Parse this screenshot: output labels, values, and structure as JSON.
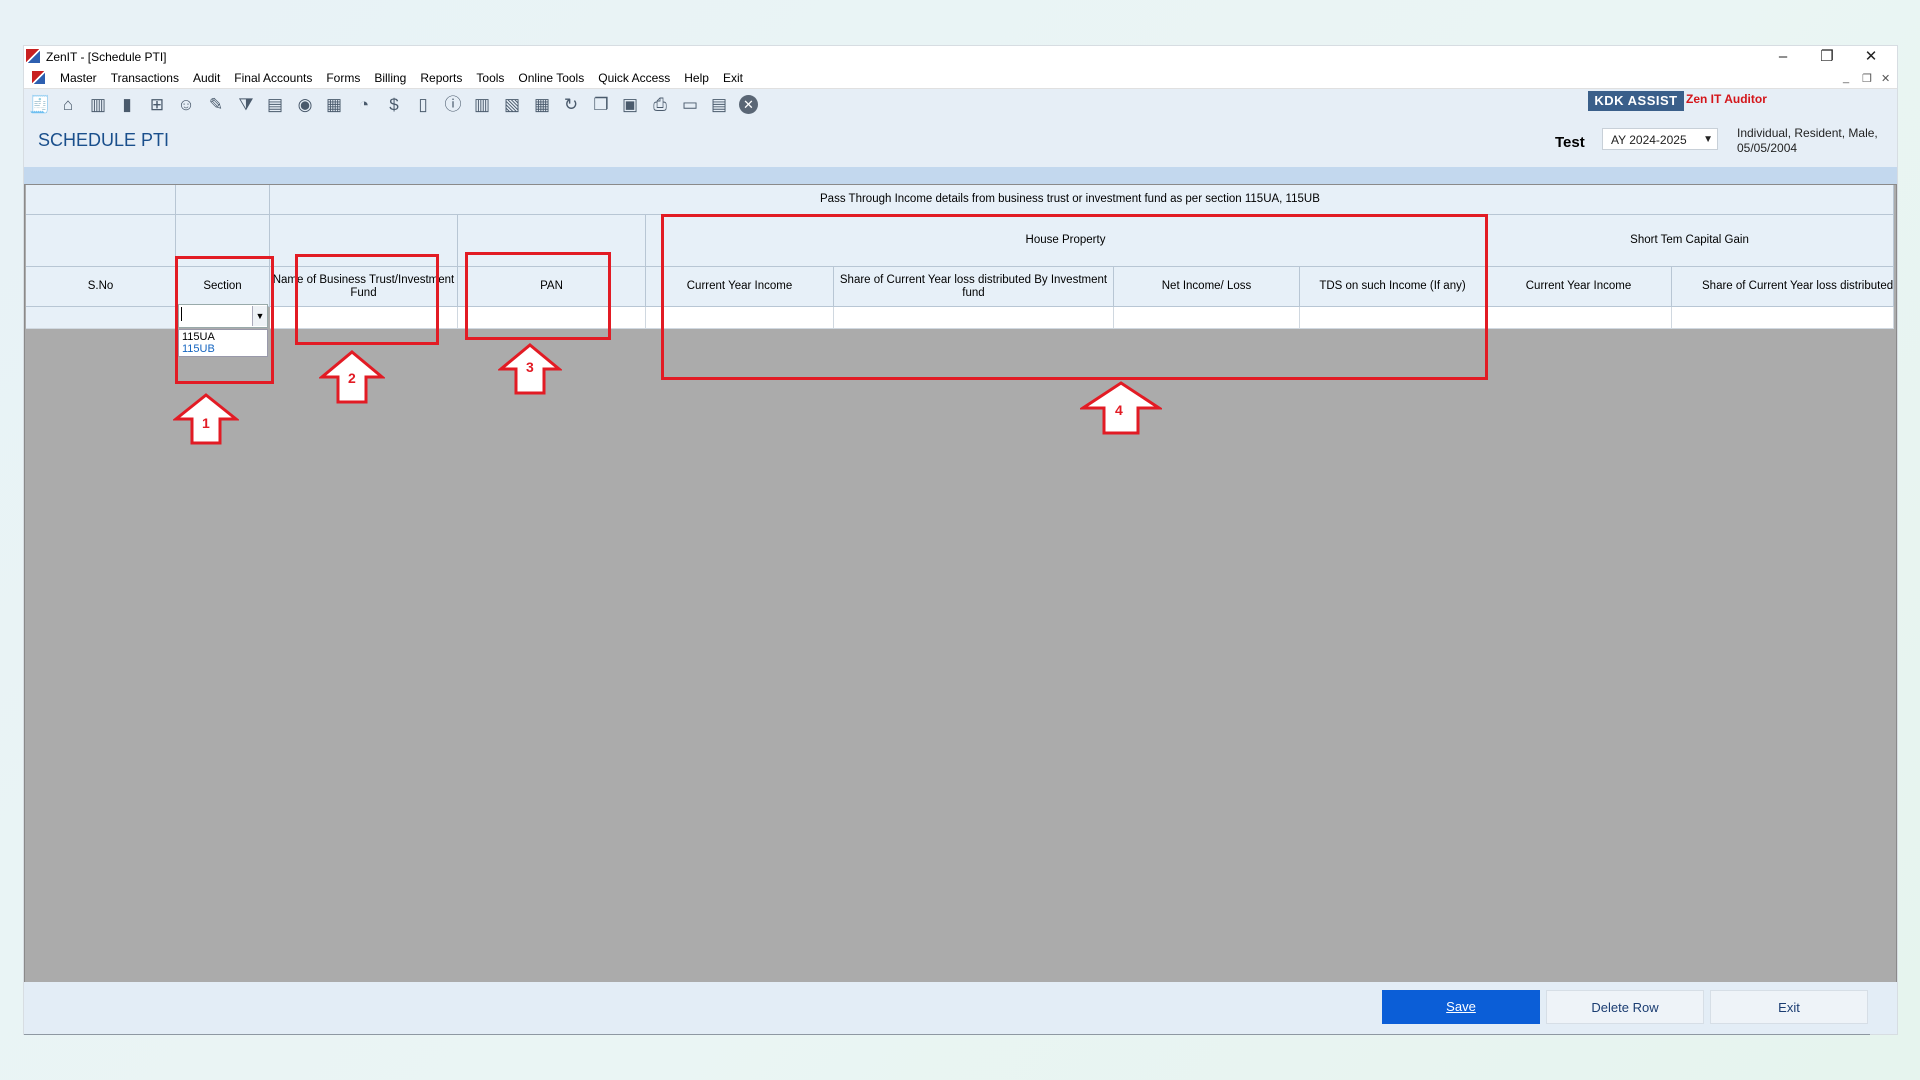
{
  "window": {
    "title": "ZenIT - [Schedule PTI]",
    "controls": [
      "–",
      "❐",
      "✕"
    ],
    "mdi_controls": [
      "_",
      "❐",
      "✕"
    ]
  },
  "menu": [
    "Master",
    "Transactions",
    "Audit",
    "Final Accounts",
    "Forms",
    "Billing",
    "Reports",
    "Tools",
    "Online Tools",
    "Quick Access",
    "Help",
    "Exit"
  ],
  "toolbar": {
    "icons": [
      "receipt-icon",
      "home-icon",
      "building-icon",
      "bar-chart-icon",
      "gift-icon",
      "people-icon",
      "tools-icon",
      "filter-icon",
      "tax-icon",
      "disc-icon",
      "calculator-icon",
      "pie-icon",
      "pay-icon",
      "book-icon",
      "info-icon",
      "report-icon",
      "document-icon",
      "calendar-icon",
      "refresh-icon",
      "copy-icon",
      "bs-icon",
      "printer-icon",
      "300-icon",
      "sheet-icon",
      "close-circle-icon"
    ],
    "kdk_label": "KDK ASSIST",
    "zen_label": "Zen IT Auditor"
  },
  "header": {
    "title": "SCHEDULE PTI",
    "client": "Test",
    "assessment_year": "AY 2024-2025",
    "client_info": "Individual, Resident, Male, 05/05/2004"
  },
  "grid": {
    "banner": "Pass Through Income details from business trust or investment fund as per section 115UA, 115UB",
    "groups": [
      "House Property",
      "Short Tem Capital Gain"
    ],
    "columns": [
      "S.No",
      "Section",
      "Name of Business Trust/Investment Fund",
      "PAN",
      "Current Year Income",
      "Share of Current Year loss distributed By Investment fund",
      "Net Income/ Loss",
      "TDS on such Income (If any)",
      "Current Year Income",
      "Share of Current Year loss distributed By Investment fund"
    ],
    "section_options": [
      "115UA",
      "115UB"
    ]
  },
  "buttons": {
    "save": "Save",
    "delete_row": "Delete Row",
    "exit": "Exit"
  },
  "annotations": {
    "labels": [
      "1",
      "2",
      "3",
      "4"
    ],
    "color": "#e21b24"
  }
}
